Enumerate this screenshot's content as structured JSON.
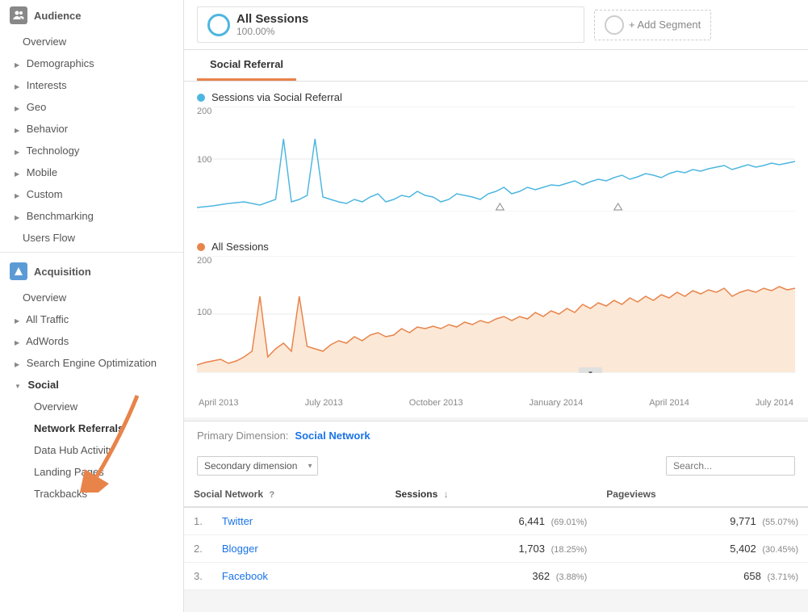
{
  "sidebar": {
    "audience_label": "Audience",
    "acquisition_label": "Acquisition",
    "items_audience": [
      {
        "label": "Overview",
        "type": "plain",
        "name": "overview"
      },
      {
        "label": "Demographics",
        "type": "arrow",
        "name": "demographics"
      },
      {
        "label": "Interests",
        "type": "arrow",
        "name": "interests"
      },
      {
        "label": "Geo",
        "type": "arrow",
        "name": "geo"
      },
      {
        "label": "Behavior",
        "type": "arrow",
        "name": "behavior"
      },
      {
        "label": "Technology",
        "type": "arrow",
        "name": "technology"
      },
      {
        "label": "Mobile",
        "type": "arrow",
        "name": "mobile"
      },
      {
        "label": "Custom",
        "type": "arrow",
        "name": "custom"
      },
      {
        "label": "Benchmarking",
        "type": "arrow",
        "name": "benchmarking"
      },
      {
        "label": "Users Flow",
        "type": "plain",
        "name": "users-flow"
      }
    ],
    "items_acquisition": [
      {
        "label": "Overview",
        "type": "plain",
        "name": "acq-overview"
      },
      {
        "label": "All Traffic",
        "type": "arrow",
        "name": "all-traffic"
      },
      {
        "label": "AdWords",
        "type": "arrow",
        "name": "adwords"
      },
      {
        "label": "Search Engine Optimization",
        "type": "arrow",
        "name": "seo"
      },
      {
        "label": "Social",
        "type": "expanded",
        "name": "social"
      }
    ],
    "social_sub_items": [
      {
        "label": "Overview",
        "name": "social-overview"
      },
      {
        "label": "Network Referrals",
        "name": "network-referrals",
        "active": true
      },
      {
        "label": "Data Hub Activity",
        "name": "data-hub-activity"
      },
      {
        "label": "Landing Pages",
        "name": "landing-pages"
      },
      {
        "label": "Trackbacks",
        "name": "trackbacks"
      }
    ]
  },
  "segment": {
    "name": "All Sessions",
    "pct": "100.00%",
    "add_label": "+ Add Segment"
  },
  "tab": {
    "label": "Social Referral"
  },
  "chart1": {
    "legend": "Sessions via Social Referral",
    "y_max": "200",
    "y_mid": "100",
    "color": "#4db6e0"
  },
  "chart2": {
    "legend": "All Sessions",
    "y_max": "200",
    "y_mid": "100",
    "color": "#e8834a"
  },
  "x_axis_labels": [
    "April 2013",
    "July 2013",
    "October 2013",
    "January 2014",
    "April 2014",
    "July 2014"
  ],
  "dimension": {
    "label": "Primary Dimension:",
    "value": "Social Network"
  },
  "secondary_dimension": {
    "label": "Secondary dimension",
    "placeholder": "Secondary dimension"
  },
  "table": {
    "headers": [
      {
        "label": "Social Network",
        "name": "col-social-network",
        "sortable": false
      },
      {
        "label": "Sessions",
        "name": "col-sessions",
        "sortable": true,
        "sorted": true
      },
      {
        "label": "",
        "name": "col-sort-arrow"
      },
      {
        "label": "Pageviews",
        "name": "col-pageviews",
        "sortable": false
      }
    ],
    "rows": [
      {
        "rank": "1.",
        "network": "Twitter",
        "sessions": "6,441",
        "sessions_pct": "(69.01%)",
        "pageviews": "9,771",
        "pageviews_pct": "(55.07%)"
      },
      {
        "rank": "2.",
        "network": "Blogger",
        "sessions": "1,703",
        "sessions_pct": "(18.25%)",
        "pageviews": "5,402",
        "pageviews_pct": "(30.45%)"
      },
      {
        "rank": "3.",
        "network": "Facebook",
        "sessions": "362",
        "sessions_pct": "(3.88%)",
        "pageviews": "658",
        "pageviews_pct": "(3.71%)"
      }
    ]
  }
}
